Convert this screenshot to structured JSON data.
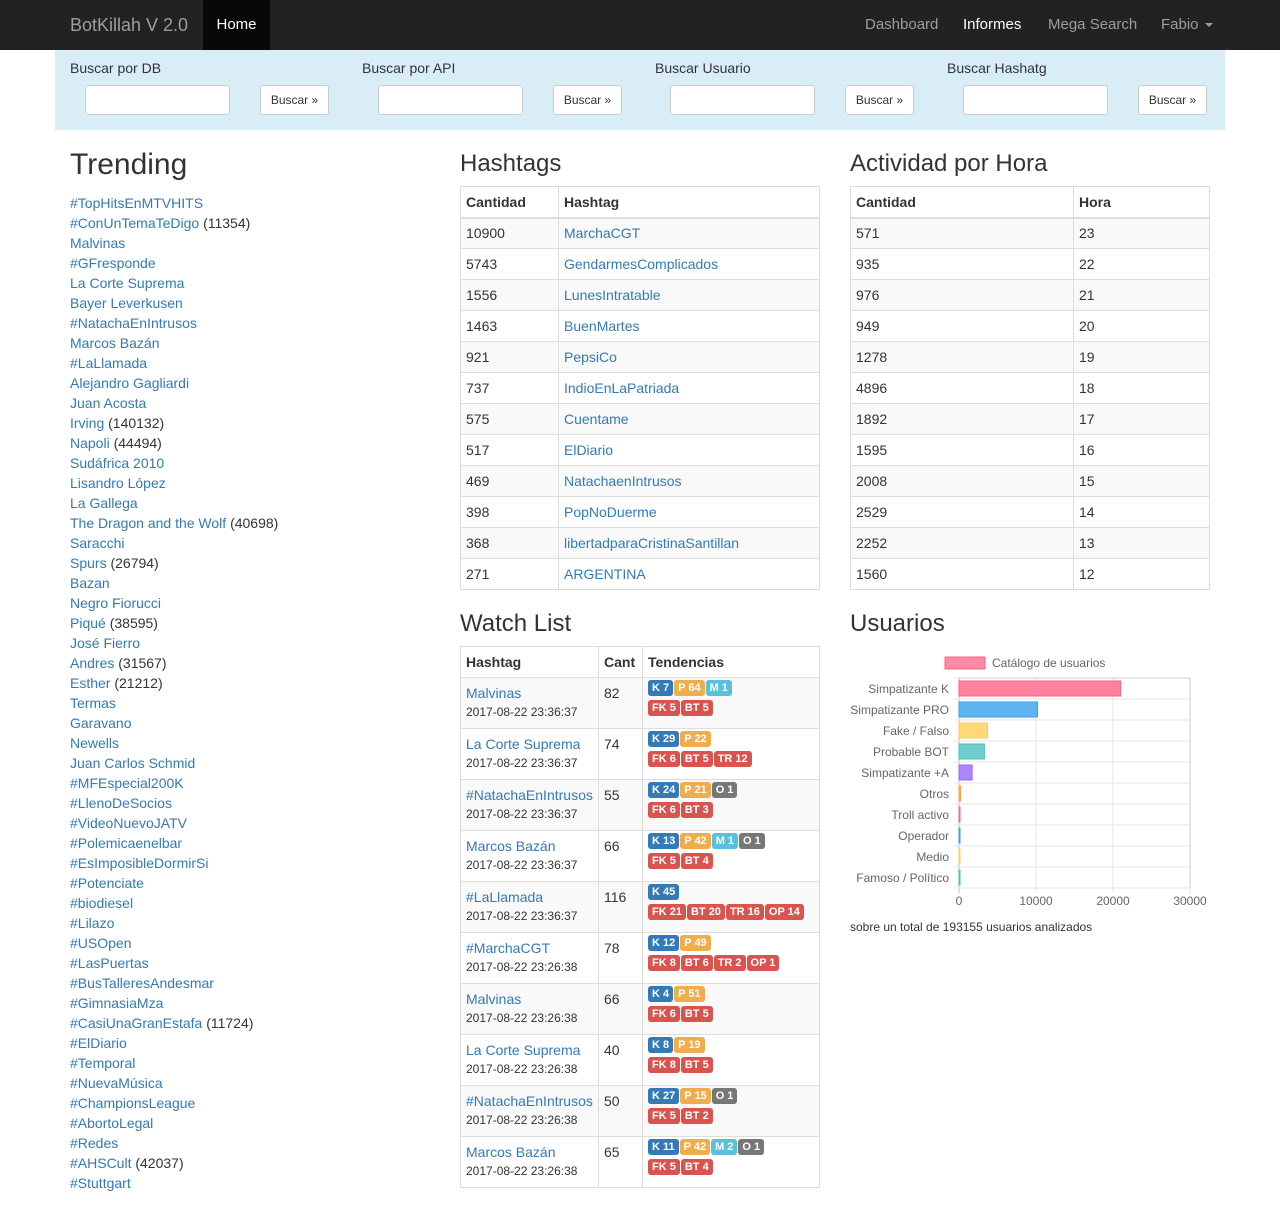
{
  "navbar": {
    "brand": "BotKillah V 2.0",
    "home": "Home",
    "items": [
      "Dashboard",
      "Informes",
      "Mega Search",
      "Fabio"
    ]
  },
  "search": {
    "groups": [
      {
        "label": "Buscar por DB",
        "button": "Buscar »"
      },
      {
        "label": "Buscar por API",
        "button": "Buscar »"
      },
      {
        "label": "Buscar Usuario",
        "button": "Buscar »"
      },
      {
        "label": "Buscar Hashatg",
        "button": "Buscar »"
      }
    ]
  },
  "trending": {
    "title": "Trending",
    "items": [
      {
        "label": "#TopHitsEnMTVHITS",
        "count": ""
      },
      {
        "label": "#ConUnTemaTeDigo",
        "count": "(11354)"
      },
      {
        "label": "Malvinas",
        "count": ""
      },
      {
        "label": "#GFresponde",
        "count": ""
      },
      {
        "label": "La Corte Suprema",
        "count": ""
      },
      {
        "label": "Bayer Leverkusen",
        "count": ""
      },
      {
        "label": "#NatachaEnIntrusos",
        "count": ""
      },
      {
        "label": "Marcos Bazán",
        "count": ""
      },
      {
        "label": "#LaLlamada",
        "count": ""
      },
      {
        "label": "Alejandro Gagliardi",
        "count": ""
      },
      {
        "label": "Juan Acosta",
        "count": ""
      },
      {
        "label": "Irving",
        "count": "(140132)"
      },
      {
        "label": "Napoli",
        "count": "(44494)"
      },
      {
        "label": "Sudáfrica 2010",
        "count": ""
      },
      {
        "label": "Lisandro López",
        "count": ""
      },
      {
        "label": "La Gallega",
        "count": ""
      },
      {
        "label": "The Dragon and the Wolf",
        "count": "(40698)"
      },
      {
        "label": "Saracchi",
        "count": ""
      },
      {
        "label": "Spurs",
        "count": "(26794)"
      },
      {
        "label": "Bazan",
        "count": ""
      },
      {
        "label": "Negro Fiorucci",
        "count": ""
      },
      {
        "label": "Piqué",
        "count": "(38595)"
      },
      {
        "label": "José Fierro",
        "count": ""
      },
      {
        "label": "Andres",
        "count": "(31567)"
      },
      {
        "label": "Esther",
        "count": "(21212)"
      },
      {
        "label": "Termas",
        "count": ""
      },
      {
        "label": "Garavano",
        "count": ""
      },
      {
        "label": "Newells",
        "count": ""
      },
      {
        "label": "Juan Carlos Schmid",
        "count": ""
      },
      {
        "label": "#MFEspecial200K",
        "count": ""
      },
      {
        "label": "#LlenoDeSocios",
        "count": ""
      },
      {
        "label": "#VideoNuevoJATV",
        "count": ""
      },
      {
        "label": "#Polemicaenelbar",
        "count": ""
      },
      {
        "label": "#EsImposibleDormirSi",
        "count": ""
      },
      {
        "label": "#Potenciate",
        "count": ""
      },
      {
        "label": "#biodiesel",
        "count": ""
      },
      {
        "label": "#Lilazo",
        "count": ""
      },
      {
        "label": "#USOpen",
        "count": ""
      },
      {
        "label": "#LasPuertas",
        "count": ""
      },
      {
        "label": "#BusTalleresAndesmar",
        "count": ""
      },
      {
        "label": "#GimnasiaMza",
        "count": ""
      },
      {
        "label": "#CasiUnaGranEstafa",
        "count": "(11724)"
      },
      {
        "label": "#ElDiario",
        "count": ""
      },
      {
        "label": "#Temporal",
        "count": ""
      },
      {
        "label": "#NuevaMúsica",
        "count": ""
      },
      {
        "label": "#ChampionsLeague",
        "count": ""
      },
      {
        "label": "#AbortoLegal",
        "count": ""
      },
      {
        "label": "#Redes",
        "count": ""
      },
      {
        "label": "#AHSCult",
        "count": "(42037)"
      },
      {
        "label": "#Stuttgart",
        "count": ""
      }
    ]
  },
  "hashtags": {
    "title": "Hashtags",
    "columns": [
      "Cantidad",
      "Hashtag"
    ],
    "rows": [
      [
        "10900",
        "MarchaCGT"
      ],
      [
        "5743",
        "GendarmesComplicados"
      ],
      [
        "1556",
        "LunesIntratable"
      ],
      [
        "1463",
        "BuenMartes"
      ],
      [
        "921",
        "PepsiCo"
      ],
      [
        "737",
        "IndioEnLaPatriada"
      ],
      [
        "575",
        "Cuentame"
      ],
      [
        "517",
        "ElDiario"
      ],
      [
        "469",
        "NatachaenIntrusos"
      ],
      [
        "398",
        "PopNoDuerme"
      ],
      [
        "368",
        "libertadparaCristinaSantillan"
      ],
      [
        "271",
        "ARGENTINA"
      ]
    ]
  },
  "actividad": {
    "title": "Actividad por Hora",
    "columns": [
      "Cantidad",
      "Hora"
    ],
    "rows": [
      [
        "571",
        "23"
      ],
      [
        "935",
        "22"
      ],
      [
        "976",
        "21"
      ],
      [
        "949",
        "20"
      ],
      [
        "1278",
        "19"
      ],
      [
        "4896",
        "18"
      ],
      [
        "1892",
        "17"
      ],
      [
        "1595",
        "16"
      ],
      [
        "2008",
        "15"
      ],
      [
        "2529",
        "14"
      ],
      [
        "2252",
        "13"
      ],
      [
        "1560",
        "12"
      ]
    ]
  },
  "watchlist": {
    "title": "Watch List",
    "columns": [
      "Hashtag",
      "Cant",
      "Tendencias"
    ],
    "rows": [
      {
        "hashtag": "Malvinas",
        "date": "2017-08-22 23:36:37",
        "cant": "82",
        "row1": [
          [
            "K",
            "K 7"
          ],
          [
            "P",
            "P 64"
          ],
          [
            "M",
            "M 1"
          ]
        ],
        "row2": [
          [
            "FK",
            "FK 5"
          ],
          [
            "BT",
            "BT 5"
          ]
        ]
      },
      {
        "hashtag": "La Corte Suprema",
        "date": "2017-08-22 23:36:37",
        "cant": "74",
        "row1": [
          [
            "K",
            "K 29"
          ],
          [
            "P",
            "P 22"
          ]
        ],
        "row2": [
          [
            "FK",
            "FK 6"
          ],
          [
            "BT",
            "BT 5"
          ],
          [
            "TR",
            "TR 12"
          ]
        ]
      },
      {
        "hashtag": "#NatachaEnIntrusos",
        "date": "2017-08-22 23:36:37",
        "cant": "55",
        "row1": [
          [
            "K",
            "K 24"
          ],
          [
            "P",
            "P 21"
          ],
          [
            "O",
            "O 1"
          ]
        ],
        "row2": [
          [
            "FK",
            "FK 6"
          ],
          [
            "BT",
            "BT 3"
          ]
        ]
      },
      {
        "hashtag": "Marcos Bazán",
        "date": "2017-08-22 23:36:37",
        "cant": "66",
        "row1": [
          [
            "K",
            "K 13"
          ],
          [
            "P",
            "P 42"
          ],
          [
            "M",
            "M 1"
          ],
          [
            "O",
            "O 1"
          ]
        ],
        "row2": [
          [
            "FK",
            "FK 5"
          ],
          [
            "BT",
            "BT 4"
          ]
        ]
      },
      {
        "hashtag": "#LaLlamada",
        "date": "2017-08-22 23:36:37",
        "cant": "116",
        "row1": [
          [
            "K",
            "K 45"
          ]
        ],
        "row2": [
          [
            "FK",
            "FK 21"
          ],
          [
            "BT",
            "BT 20"
          ],
          [
            "TR",
            "TR 16"
          ],
          [
            "OP",
            "OP 14"
          ]
        ]
      },
      {
        "hashtag": "#MarchaCGT",
        "date": "2017-08-22 23:26:38",
        "cant": "78",
        "row1": [
          [
            "K",
            "K 12"
          ],
          [
            "P",
            "P 49"
          ]
        ],
        "row2": [
          [
            "FK",
            "FK 8"
          ],
          [
            "BT",
            "BT 6"
          ],
          [
            "TR",
            "TR 2"
          ],
          [
            "OP",
            "OP 1"
          ]
        ]
      },
      {
        "hashtag": "Malvinas",
        "date": "2017-08-22 23:26:38",
        "cant": "66",
        "row1": [
          [
            "K",
            "K 4"
          ],
          [
            "P",
            "P 51"
          ]
        ],
        "row2": [
          [
            "FK",
            "FK 6"
          ],
          [
            "BT",
            "BT 5"
          ]
        ]
      },
      {
        "hashtag": "La Corte Suprema",
        "date": "2017-08-22 23:26:38",
        "cant": "40",
        "row1": [
          [
            "K",
            "K 8"
          ],
          [
            "P",
            "P 19"
          ]
        ],
        "row2": [
          [
            "FK",
            "FK 8"
          ],
          [
            "BT",
            "BT 5"
          ]
        ]
      },
      {
        "hashtag": "#NatachaEnIntrusos",
        "date": "2017-08-22 23:26:38",
        "cant": "50",
        "row1": [
          [
            "K",
            "K 27"
          ],
          [
            "P",
            "P 15"
          ],
          [
            "O",
            "O 1"
          ]
        ],
        "row2": [
          [
            "FK",
            "FK 5"
          ],
          [
            "BT",
            "BT 2"
          ]
        ]
      },
      {
        "hashtag": "Marcos Bazán",
        "date": "2017-08-22 23:26:38",
        "cant": "65",
        "row1": [
          [
            "K",
            "K 11"
          ],
          [
            "P",
            "P 42"
          ],
          [
            "M",
            "M 2"
          ],
          [
            "O",
            "O 1"
          ]
        ],
        "row2": [
          [
            "FK",
            "FK 5"
          ],
          [
            "BT",
            "BT 4"
          ]
        ]
      }
    ]
  },
  "usuarios": {
    "title": "Usuarios",
    "note": "sobre un total de 193155 usuarios analizados"
  },
  "chart_data": {
    "type": "bar",
    "orientation": "horizontal",
    "categories": [
      "Simpatizante K",
      "Simpatizante PRO",
      "Fake / Falso",
      "Probable BOT",
      "Simpatizante +A",
      "Otros",
      "Troll activo",
      "Operador",
      "Medio",
      "Famoso / Político"
    ],
    "series": [
      {
        "name": "Catálogo de usuarios",
        "values": [
          21000,
          10200,
          3700,
          3300,
          1700,
          200,
          100,
          100,
          50,
          50
        ]
      }
    ],
    "colors": [
      "#ff6384",
      "#36a2eb",
      "#ffce56",
      "#4bc0c0",
      "#9966ff",
      "#ff9f40",
      "#ff6384",
      "#36a2eb",
      "#ffce56",
      "#4bc0c0"
    ],
    "xlim": [
      0,
      30000
    ],
    "xticks": [
      "0",
      "10000",
      "20000",
      "30000"
    ],
    "legend": "top",
    "grid": true
  }
}
